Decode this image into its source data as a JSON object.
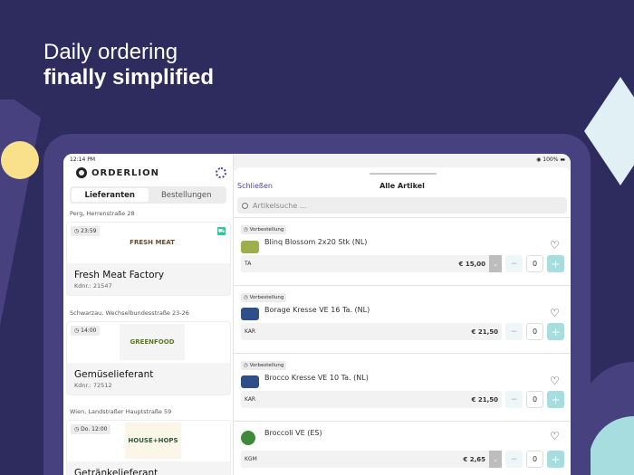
{
  "headline": {
    "line1": "Daily ordering",
    "line2": "finally simplified"
  },
  "status": {
    "time": "12:14 PM",
    "battery": "100%"
  },
  "brand": "ORDERLION",
  "tabs": [
    "Lieferanten",
    "Bestellungen"
  ],
  "suppliers": [
    {
      "address": "Perg, Herrenstraße 28",
      "time": "23:59",
      "logo": "FRESH MEAT",
      "name": "Fresh Meat Factory",
      "customer": "Kdnr.: 21547"
    },
    {
      "address": "Schwarzau, Wechselbundesstraße 23-26",
      "time": "14:00",
      "logo": "GREENFOOD",
      "name": "Gemüselieferant",
      "customer": "Kdnr.: 72512"
    },
    {
      "address": "Wien, Landstraßer Hauptstraße 59",
      "time": "Do. 12:00",
      "logo": "HOUSE+HOPS",
      "name": "Getränkelieferant",
      "customer": ""
    }
  ],
  "sheet": {
    "close": "Schließen",
    "title": "Alle Artikel",
    "search_placeholder": "Artikelsuche ..."
  },
  "items": [
    {
      "tag": "Vorbestellung",
      "name": "Blinq Blossom 2x20 Stk (NL)",
      "unit": "TA",
      "price": "€ 15,00",
      "qty": "0",
      "color": "#9bb04a"
    },
    {
      "tag": "Vorbestellung",
      "name": "Borage Kresse VE 16 Ta. (NL)",
      "unit": "KAR",
      "price": "€ 21,50",
      "qty": "0",
      "color": "#2f4f8a"
    },
    {
      "tag": "Vorbestellung",
      "name": "Brocco Kresse VE 10 Ta. (NL)",
      "unit": "KAR",
      "price": "€ 21,50",
      "qty": "0",
      "color": "#2f4f8a"
    },
    {
      "tag": "",
      "name": "Broccoli VE (ES)",
      "unit": "KGM",
      "price": "€ 2,65",
      "qty": "0",
      "color": "#3f8a3a"
    }
  ]
}
